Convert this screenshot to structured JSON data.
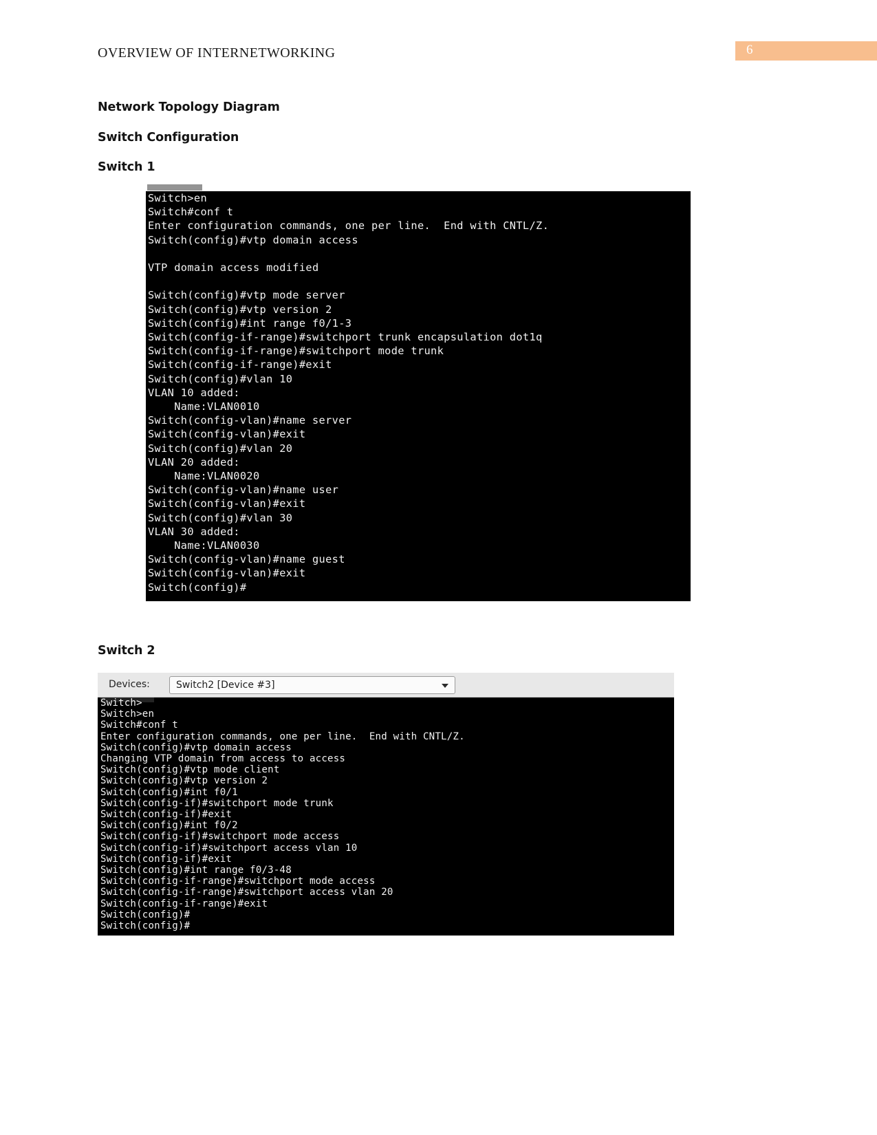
{
  "header": {
    "running_title": "OVERVIEW OF INTERNETWORKING",
    "page_number": "6",
    "banner_color": "#f8be8e"
  },
  "headings": {
    "topology": "Network Topology Diagram",
    "switch_configuration": "Switch Configuration",
    "switch1": "Switch 1",
    "switch2": "Switch 2"
  },
  "switch1_terminal": {
    "lines": [
      "Switch>en",
      "Switch#conf t",
      "Enter configuration commands, one per line.  End with CNTL/Z.",
      "Switch(config)#vtp domain access",
      "",
      "VTP domain access modified",
      "",
      "Switch(config)#vtp mode server",
      "Switch(config)#vtp version 2",
      "Switch(config)#int range f0/1-3",
      "Switch(config-if-range)#switchport trunk encapsulation dot1q",
      "Switch(config-if-range)#switchport mode trunk",
      "Switch(config-if-range)#exit",
      "Switch(config)#vlan 10",
      "VLAN 10 added:",
      "    Name:VLAN0010",
      "Switch(config-vlan)#name server",
      "Switch(config-vlan)#exit",
      "Switch(config)#vlan 20",
      "VLAN 20 added:",
      "    Name:VLAN0020",
      "Switch(config-vlan)#name user",
      "Switch(config-vlan)#exit",
      "Switch(config)#vlan 30",
      "VLAN 30 added:",
      "    Name:VLAN0030",
      "Switch(config-vlan)#name guest",
      "Switch(config-vlan)#exit",
      "Switch(config)#"
    ]
  },
  "switch2_toolbar": {
    "devices_label": "Devices:",
    "selected_device": "Switch2 [Device #3]"
  },
  "switch2_terminal": {
    "lines": [
      "Switch>",
      "Switch>en",
      "Switch#conf t",
      "Enter configuration commands, one per line.  End with CNTL/Z.",
      "Switch(config)#vtp domain access",
      "Changing VTP domain from access to access",
      "Switch(config)#vtp mode client",
      "Switch(config)#vtp version 2",
      "Switch(config)#int f0/1",
      "Switch(config-if)#switchport mode trunk",
      "Switch(config-if)#exit",
      "Switch(config)#int f0/2",
      "Switch(config-if)#switchport mode access",
      "Switch(config-if)#switchport access vlan 10",
      "Switch(config-if)#exit",
      "Switch(config)#int range f0/3-48",
      "Switch(config-if-range)#switchport mode access",
      "Switch(config-if-range)#switchport access vlan 20",
      "Switch(config-if-range)#exit",
      "Switch(config)#",
      "Switch(config)#"
    ]
  }
}
